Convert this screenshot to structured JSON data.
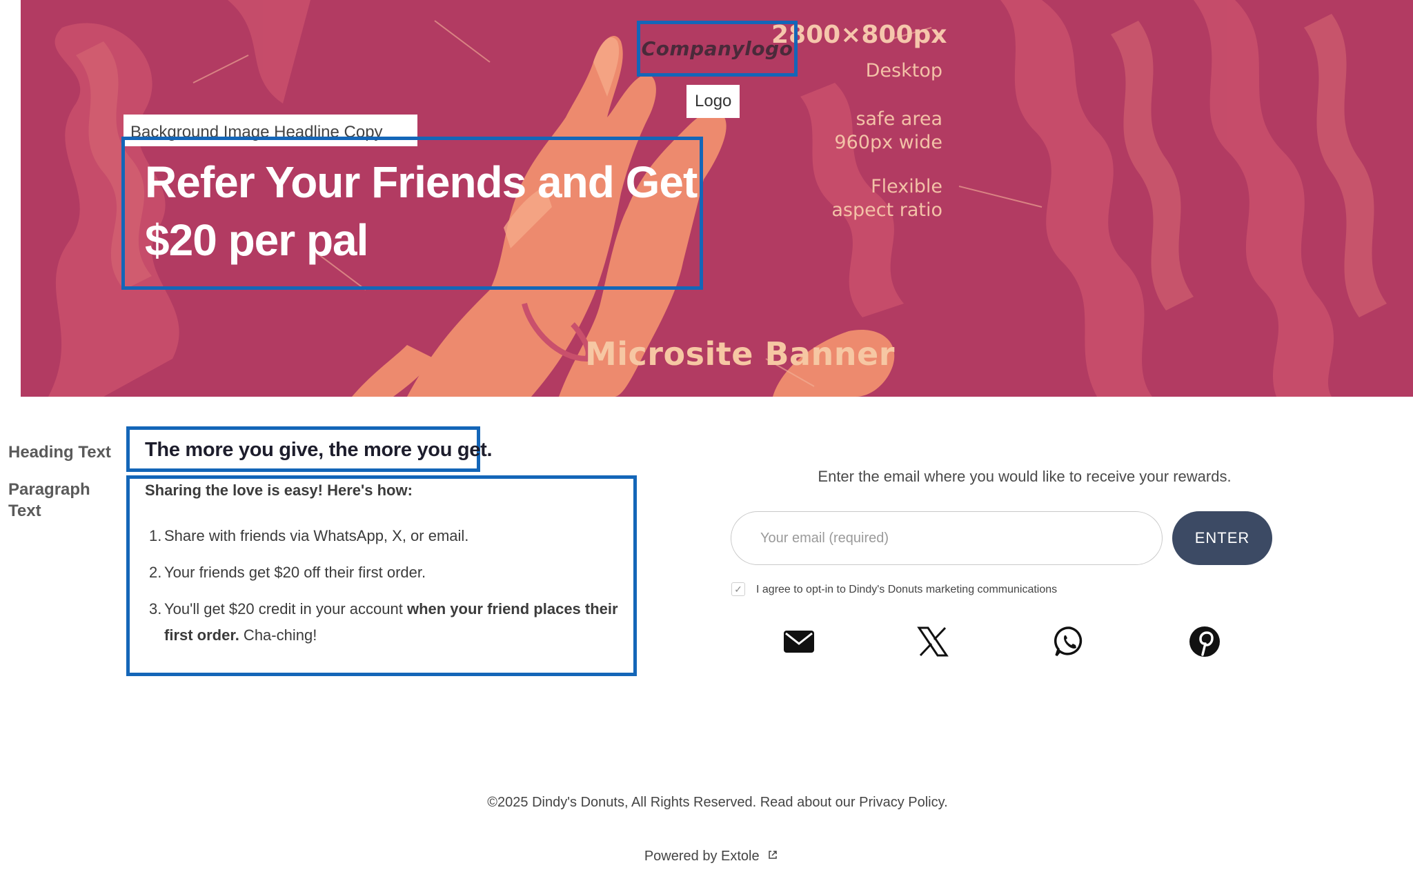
{
  "banner": {
    "size_note": "2800×800px",
    "desktop_note": "Desktop",
    "safe_area_note": [
      "safe area",
      "960px wide"
    ],
    "flexible_note": [
      "Flexible",
      "aspect ratio"
    ],
    "microsite_label": "Microsite Banner",
    "logo_text": "Companylogo",
    "logo_tag": "Logo",
    "headline_tag": "Background Image Headline Copy",
    "headline_line1": "Refer Your Friends and Get",
    "headline_line2": "$20 per pal",
    "background_color": "#b23b62",
    "art_color": "#ed8a6e",
    "annotation_color": "#1466b8"
  },
  "annotations": {
    "heading_label": "Heading Text",
    "paragraph_label_line1": "Paragraph",
    "paragraph_label_line2": "Text"
  },
  "content": {
    "heading": "The more you give, the more you get.",
    "intro": "Sharing the love is easy! Here's how:",
    "steps": [
      {
        "num": "1.",
        "text": "Share with friends via WhatsApp, X, or email."
      },
      {
        "num": "2.",
        "text": "Your friends get $20 off their first order."
      },
      {
        "num": "3.",
        "text_before": "You'll get $20 credit in your account ",
        "text_bold": "when your friend places their first order.",
        "text_after": " Cha-ching!"
      }
    ]
  },
  "form": {
    "prompt": "Enter the email where you would like to receive your rewards.",
    "email_placeholder": "Your email (required)",
    "email_value": "",
    "enter_label": "ENTER",
    "button_color": "#3c4a64",
    "optin_checked": true,
    "optin_label": "I agree to opt-in to Dindy's Donuts marketing communications"
  },
  "share_icons": [
    "envelope-icon",
    "x-logo-icon",
    "whatsapp-icon",
    "pinterest-icon"
  ],
  "footer": {
    "copyright": "©2025 Dindy's Donuts, All Rights Reserved. Read about our Privacy Policy.",
    "powered_by": "Powered by Extole",
    "powered_icon": "external-link-icon"
  }
}
